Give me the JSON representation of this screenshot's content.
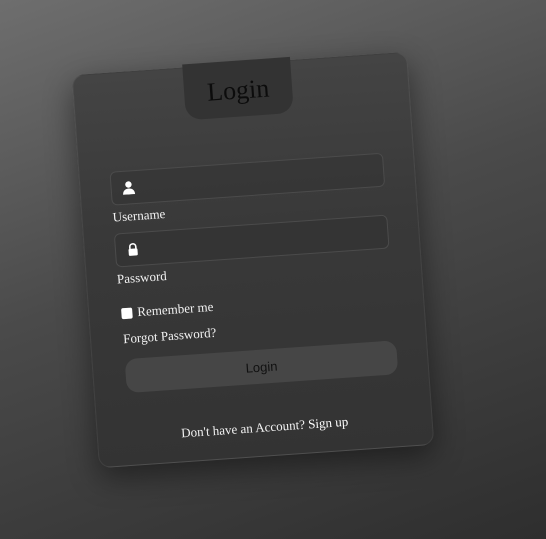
{
  "form": {
    "title": "Login",
    "username_label": "Username",
    "password_label": "Password",
    "remember_label": "Remember me",
    "forgot_label": "Forgot Password?",
    "login_button": "Login",
    "signup_prompt": "Don't have an Account?",
    "signup_link": "Sign up",
    "username_icon": "user-icon",
    "password_icon": "lock-icon"
  },
  "colors": {
    "card": "#3a3a3a",
    "tab": "#333333",
    "text": "#f2f2f2",
    "button": "#464646"
  }
}
